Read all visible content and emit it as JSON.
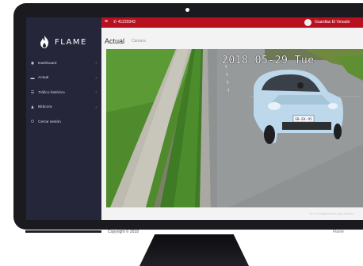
{
  "app": {
    "brand_name": "FLAME",
    "brand_color": "#b91020"
  },
  "topbar": {
    "phone_number": "41230343",
    "user_name": "Guardias El Venado"
  },
  "sidebar": {
    "items": [
      {
        "label": "Dashboard",
        "icon": "dashboard-icon",
        "has_submenu": true
      },
      {
        "label": "Actual",
        "icon": "video-camera-icon",
        "has_submenu": true
      },
      {
        "label": "Tráfico histórico",
        "icon": "list-icon",
        "has_submenu": true
      },
      {
        "label": "Bitácora",
        "icon": "user-icon",
        "has_submenu": true
      },
      {
        "label": "Cerrar sesión",
        "icon": "power-icon",
        "has_submenu": false
      }
    ]
  },
  "main": {
    "page_title": "Actual",
    "page_subtitle": "Cámara",
    "camera_timestamp": "2018 05-29 Tue",
    "license_plate": "SB-EK-95",
    "footer_note": "Ve a Configuración para activar"
  },
  "bezel": {
    "left_text": "Copyright © 2018",
    "right_text": "Flame"
  }
}
